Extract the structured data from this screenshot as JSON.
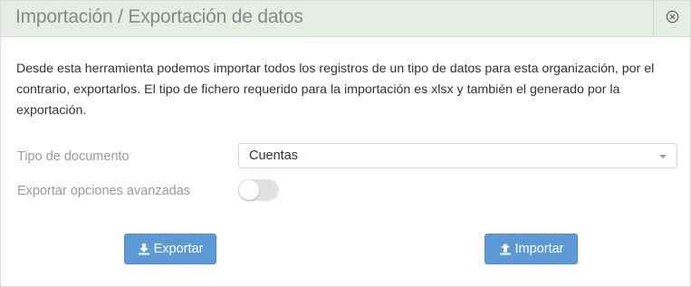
{
  "dialog": {
    "title": "Importación / Exportación de datos",
    "close_icon": "close-circle-icon"
  },
  "description": "Desde esta herramienta podemos importar todos los registros de un tipo de datos para esta organización, por el contrario, exportarlos. El tipo de fichero requerido para la importación es xlsx y también el generado por la exportación.",
  "form": {
    "document_type_label": "Tipo de documento",
    "document_type_value": "Cuentas",
    "advanced_options_label": "Exportar opciones avanzadas",
    "advanced_options_enabled": false
  },
  "actions": {
    "export_label": "Exportar",
    "export_icon": "download-icon",
    "import_label": "Importar",
    "import_icon": "upload-icon"
  },
  "colors": {
    "header_bg": "#e5ede5",
    "button_bg": "#5b9ad5",
    "label_text": "#9a9a9a"
  }
}
